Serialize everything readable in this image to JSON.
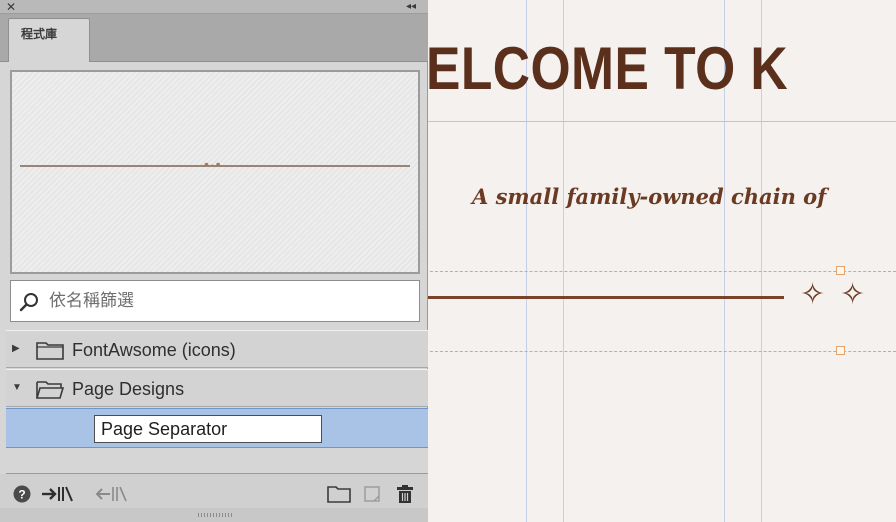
{
  "panel": {
    "close_glyph": "✕",
    "collapse_glyph": "◂◂",
    "tab_label": "程式庫",
    "search": {
      "placeholder": "依名稱篩選",
      "icon": "search-icon"
    },
    "tree": [
      {
        "label": "FontAwsome (icons)",
        "expanded": false,
        "icon": "folder-icon"
      },
      {
        "label": "Page Designs",
        "expanded": true,
        "icon": "folder-open-icon"
      }
    ],
    "selected_item": {
      "value": "Page Separator"
    },
    "bottom_icons": [
      "help-icon",
      "place-item-icon",
      "add-item-icon",
      "new-group-icon",
      "new-item-icon",
      "delete-icon"
    ]
  },
  "document": {
    "headline": "ELCOME TO K",
    "tagline": "A small family-owned chain of",
    "ornament": "✧✧"
  },
  "colors": {
    "headline": "#5a2f1c",
    "selection": "#a8c3e6",
    "guide": "#e6a36b"
  }
}
